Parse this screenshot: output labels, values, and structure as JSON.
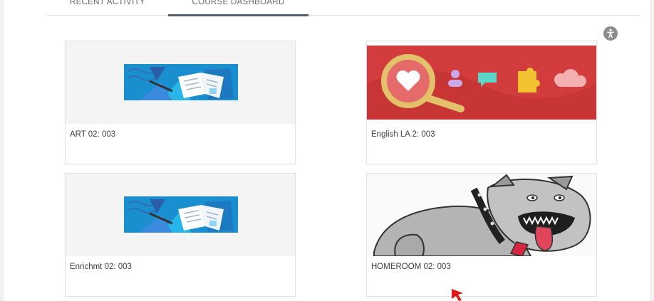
{
  "tabs": [
    {
      "label": "RECENT ACTIVITY"
    },
    {
      "label": "COURSE DASHBOARD",
      "active": true
    }
  ],
  "accessibility_button": {
    "icon": "accessibility-icon"
  },
  "courses": [
    {
      "title": "ART 02: 003",
      "image": "art-book-banner"
    },
    {
      "title": "English LA 2: 003",
      "image": "heart-magnifier-banner"
    },
    {
      "title": "Enrichmt 02: 003",
      "image": "art-book-banner"
    },
    {
      "title": "HOMEROOM 02: 003",
      "image": "bulldog-mascot"
    }
  ],
  "colors": {
    "active_tab_underline": "#56606d",
    "art_banner_blue": "#1a8fcf",
    "english_banner_red": "#d23c3c",
    "pointer_red": "#e01818"
  }
}
